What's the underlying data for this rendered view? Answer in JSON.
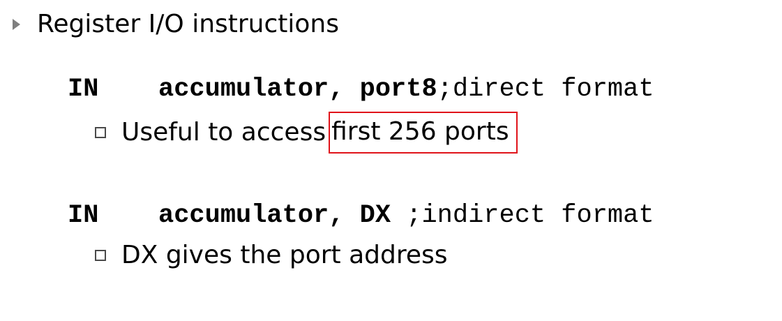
{
  "heading": {
    "text": "Register I/O instructions"
  },
  "instructions": [
    {
      "mnemonic": "IN",
      "operands": "accumulator, port8",
      "comment": ";direct format",
      "bullet_prefix": "Useful to access",
      "bullet_highlight": "first 256 ports"
    },
    {
      "mnemonic": "IN",
      "operands": "accumulator, DX ",
      "comment": ";indirect format",
      "bullet_text": "DX gives the port address"
    }
  ],
  "colors": {
    "highlight_box": "#e0131a",
    "triangle_bullet": "#7f7f7f"
  }
}
